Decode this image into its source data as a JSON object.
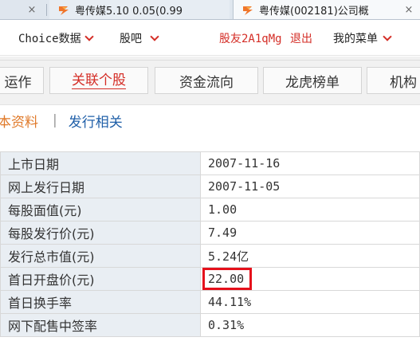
{
  "browser": {
    "tabs": [
      {
        "title": "",
        "close": "×"
      },
      {
        "title": "粤传媒5.10 0.05(0.99",
        "close": "×"
      },
      {
        "title": "粤传媒(002181)公司概",
        "close": "×"
      }
    ]
  },
  "colors": {
    "brand_red": "#d42d26",
    "highlight": "#e5101b",
    "link_blue": "#1f5fa8",
    "active_orange": "#e07a2a"
  },
  "topnav": {
    "choice": "Choice数据",
    "guba": "股吧",
    "user": "股友2A1qMg",
    "logout": "退出",
    "my_menu": "我的菜单"
  },
  "sections": [
    "运作",
    "关联个股",
    "资金流向",
    "龙虎榜单",
    "机构"
  ],
  "sublinks": {
    "active": "本资料",
    "separator": "|",
    "issue": "发行相关"
  },
  "table": {
    "rows": [
      {
        "label": "上市日期",
        "value": "2007-11-16"
      },
      {
        "label": "网上发行日期",
        "value": "2007-11-05"
      },
      {
        "label": "每股面值(元)",
        "value": "1.00"
      },
      {
        "label": "每股发行价(元)",
        "value": "7.49"
      },
      {
        "label": "发行总市值(元)",
        "value": "5.24亿"
      },
      {
        "label": "首日开盘价(元)",
        "value": "22.00"
      },
      {
        "label": "首日换手率",
        "value": "44.11%"
      },
      {
        "label": "网下配售中签率",
        "value": "0.31%"
      }
    ],
    "highlighted_row": "首日开盘价(元)"
  }
}
